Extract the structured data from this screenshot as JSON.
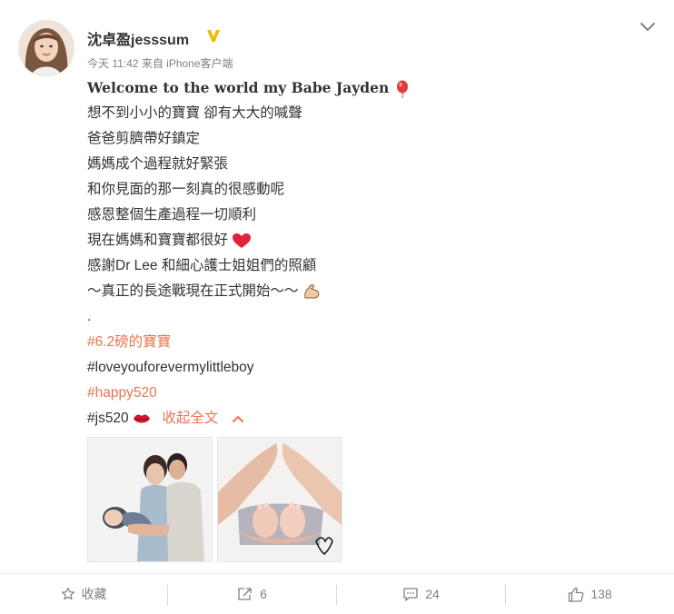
{
  "post": {
    "author": "沈卓盈jesssum",
    "time": "今天 11:42",
    "source": "来自 iPhone客户端",
    "lines": [
      "Welcome to the world my  Babe Jayden",
      "想不到小小的寶寶 卻有大大的喊聲",
      "爸爸剪臍帶好鎮定",
      "媽媽成个過程就好緊張",
      "和你見面的那一刻真的很感動呢",
      "感恩整個生產過程一切順利",
      "現在媽媽和寶寶都很好",
      "感謝Dr Lee 和細心護士姐姐們的照顧",
      "～真正的長途戰現在正式開始～～",
      "."
    ],
    "tags": [
      "#6.2磅的寶寶",
      "#loveyouforevermylittleboy",
      "#happy520",
      "#js520"
    ],
    "collapse_label": "收起全文"
  },
  "actions": {
    "favorite": "收藏",
    "repost": "6",
    "comment": "24",
    "like": "138"
  },
  "colors": {
    "accent": "#eb7350",
    "verified": "#f7b500",
    "text": "#333333",
    "muted": "#808080"
  },
  "icons": {
    "emoji_balloon": "balloon-icon",
    "emoji_heart": "red-heart-icon",
    "emoji_muscle": "flexed-biceps-icon",
    "emoji_lips": "kiss-lips-icon"
  }
}
